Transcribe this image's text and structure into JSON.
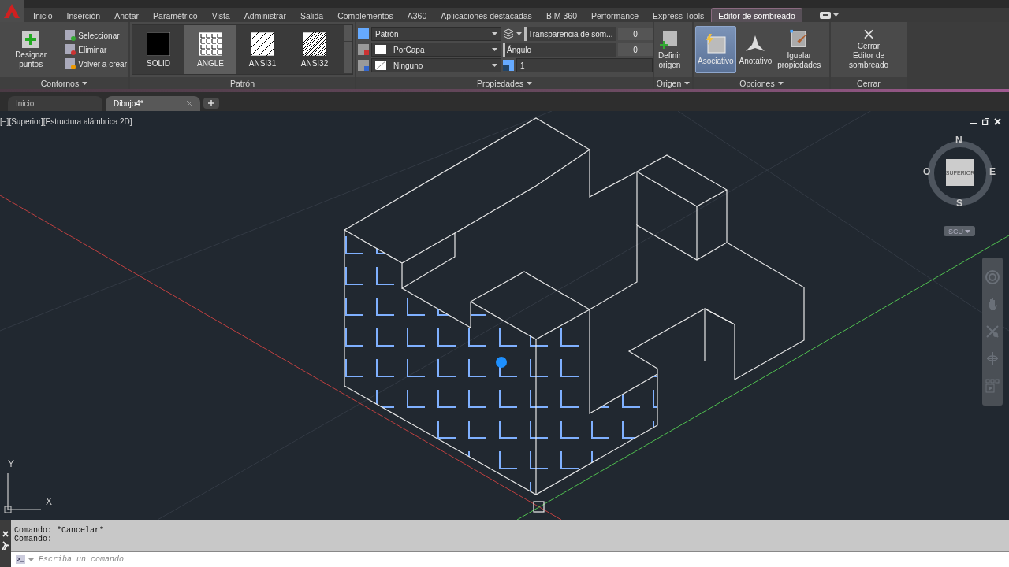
{
  "ribbon_tabs": [
    {
      "label": "Inicio",
      "selected": false
    },
    {
      "label": "Inserción",
      "selected": false
    },
    {
      "label": "Anotar",
      "selected": false
    },
    {
      "label": "Paramétrico",
      "selected": false
    },
    {
      "label": "Vista",
      "selected": false
    },
    {
      "label": "Administrar",
      "selected": false
    },
    {
      "label": "Salida",
      "selected": false
    },
    {
      "label": "Complementos",
      "selected": false
    },
    {
      "label": "A360",
      "selected": false
    },
    {
      "label": "Aplicaciones destacadas",
      "selected": false
    },
    {
      "label": "BIM 360",
      "selected": false
    },
    {
      "label": "Performance",
      "selected": false
    },
    {
      "label": "Express Tools",
      "selected": false
    },
    {
      "label": "Editor de sombreado",
      "selected": true
    }
  ],
  "contornos": {
    "title": "Contornos",
    "main": "Designar puntos",
    "actions": [
      "Seleccionar",
      "Eliminar",
      "Volver a crear"
    ]
  },
  "patron": {
    "title": "Patrón",
    "patterns": [
      {
        "label": "SOLID",
        "kind": "solid",
        "selected": false
      },
      {
        "label": "ANGLE",
        "kind": "angle",
        "selected": true
      },
      {
        "label": "ANSI31",
        "kind": "ansi31",
        "selected": false
      },
      {
        "label": "ANSI32",
        "kind": "ansi32",
        "selected": false
      }
    ]
  },
  "propiedades": {
    "title": "Propiedades",
    "type": "Patrón",
    "hatch_color": "PorCapa",
    "background": "Ninguno",
    "transparency": {
      "label": "Transparencia de som...",
      "value": "0"
    },
    "angle": {
      "label": "Ángulo",
      "value": "0"
    },
    "scale": "1"
  },
  "origen": {
    "title": "Origen",
    "button": "Definir\norigen"
  },
  "opciones": {
    "title": "Opciones",
    "items": [
      {
        "label": "Asociativo",
        "kind": "associative",
        "selected": true
      },
      {
        "label": "Anotativo",
        "kind": "annotative",
        "selected": false
      },
      {
        "label": "Igualar\npropiedades",
        "kind": "match",
        "selected": false
      }
    ]
  },
  "cerrar": {
    "title": "Cerrar",
    "button": "Cerrar\nEditor de sombreado"
  },
  "doc_tabs": [
    {
      "label": "Inicio",
      "selected": false
    },
    {
      "label": "Dibujo4*",
      "selected": true
    }
  ],
  "viewport": {
    "header": "[−][Superior][Estructura alámbrica 2D]",
    "viewcube": {
      "north": "N",
      "south": "S",
      "east": "E",
      "west": "O",
      "face": "SUPERIOR"
    },
    "ucs_menu": "SCU",
    "ucs_axes": {
      "x": "X",
      "y": "Y"
    }
  },
  "command": {
    "history": [
      "Comando: *Cancelar*",
      "Comando:"
    ],
    "placeholder": "Escriba un comando"
  }
}
